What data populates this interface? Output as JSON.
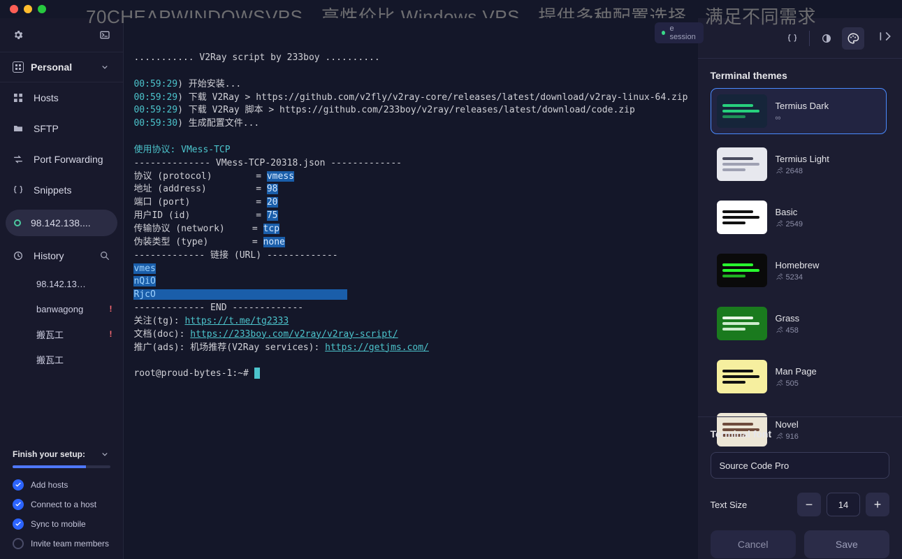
{
  "watermark": "70CHEAPWINDOWSVPS，高性价比 Windows VPS，提供多种配置选择，满足不同需求",
  "workspace": {
    "name": "Personal"
  },
  "nav": {
    "hosts": "Hosts",
    "sftp": "SFTP",
    "port_fwd": "Port Forwarding",
    "snippets": "Snippets",
    "active_session": "98.142.138....",
    "history": "History"
  },
  "sessions": [
    {
      "label": "98.142.13…",
      "warn": false
    },
    {
      "label": "banwagong",
      "warn": true
    },
    {
      "label": "搬瓦工",
      "warn": true
    },
    {
      "label": "搬瓦工",
      "warn": false
    }
  ],
  "setup": {
    "title": "Finish your setup:",
    "progress_pct": 75,
    "items": [
      {
        "label": "Add hosts",
        "done": true
      },
      {
        "label": "Connect to a host",
        "done": true
      },
      {
        "label": "Sync to mobile",
        "done": true
      },
      {
        "label": "Invite team members",
        "done": false
      }
    ]
  },
  "terminal": {
    "tab_label": "e session",
    "lines": {
      "header": "........... V2Ray script by 233boy ..........",
      "t1": "00:59:29",
      "l1": "开始安装...",
      "t2": "00:59:29",
      "l2": "下载 V2Ray > https://github.com/v2fly/v2ray-core/releases/latest/download/v2ray-linux-64.zip",
      "t3": "00:59:29",
      "l3": "下载 V2Ray 脚本 > https://github.com/233boy/v2ray/releases/latest/download/code.zip",
      "t4": "00:59:30",
      "l4": "生成配置文件...",
      "proto": "使用协议: VMess-TCP",
      "divider1": "-------------- VMess-TCP-20318.json -------------",
      "cfg1_label": "协议 (protocol)        = ",
      "cfg1_val": "vmess",
      "cfg2_label": "地址 (address)         = ",
      "cfg2_val": "98",
      "cfg3_label": "端口 (port)            = ",
      "cfg3_val": "20",
      "cfg4_label": "用户ID (id)            = ",
      "cfg4_val": "75",
      "cfg5_label": "传输协议 (network)     = ",
      "cfg5_val": "tcp",
      "cfg6_label": "伪装类型 (type)        = ",
      "cfg6_val": "none",
      "divider2": "------------- 链接 (URL) -------------",
      "url1": "vmes",
      "url2": "nQiO",
      "url3": "RjcO",
      "url3_tail": "                                   ",
      "divider3": "------------- END -------------",
      "tg_label": "关注(tg): ",
      "tg_url": "https://t.me/tg2333",
      "doc_label": "文档(doc): ",
      "doc_url": "https://233boy.com/v2ray/v2ray-script/",
      "ads_label": "推广(ads): 机场推荐(V2Ray services): ",
      "ads_url": "https://getjms.com/",
      "prompt": "root@proud-bytes-1:~# "
    }
  },
  "right": {
    "themes_title": "Terminal themes",
    "font_title": "Terminal font",
    "font_value": "Source Code Pro",
    "size_label": "Text Size",
    "size_value": "14",
    "cancel": "Cancel",
    "save": "Save",
    "themes": [
      {
        "name": "Termius Dark",
        "meta": "∞",
        "bg": "#16253a",
        "c1": "#27d07d",
        "c2": "#27d07d",
        "c3": "#1e8f57"
      },
      {
        "name": "Termius Light",
        "meta": "2648",
        "bg": "#e7e8ee",
        "c1": "#4a4c5e",
        "c2": "#9ea0b2",
        "c3": "#9ea0b2"
      },
      {
        "name": "Basic",
        "meta": "2549",
        "bg": "#ffffff",
        "c1": "#111111",
        "c2": "#111111",
        "c3": "#111111"
      },
      {
        "name": "Homebrew",
        "meta": "5234",
        "bg": "#0a0a0a",
        "c1": "#29ff2f",
        "c2": "#29ff2f",
        "c3": "#1fae22"
      },
      {
        "name": "Grass",
        "meta": "458",
        "bg": "#1a7a1e",
        "c1": "#e8f5e8",
        "c2": "#cdeccd",
        "c3": "#cdeccd"
      },
      {
        "name": "Man Page",
        "meta": "505",
        "bg": "#f6ef9f",
        "c1": "#111111",
        "c2": "#111111",
        "c3": "#111111"
      },
      {
        "name": "Novel",
        "meta": "916",
        "bg": "#ece6d6",
        "c1": "#6e4b3c",
        "c2": "#6e4b3c",
        "c3": "#6e4b3c"
      }
    ]
  }
}
